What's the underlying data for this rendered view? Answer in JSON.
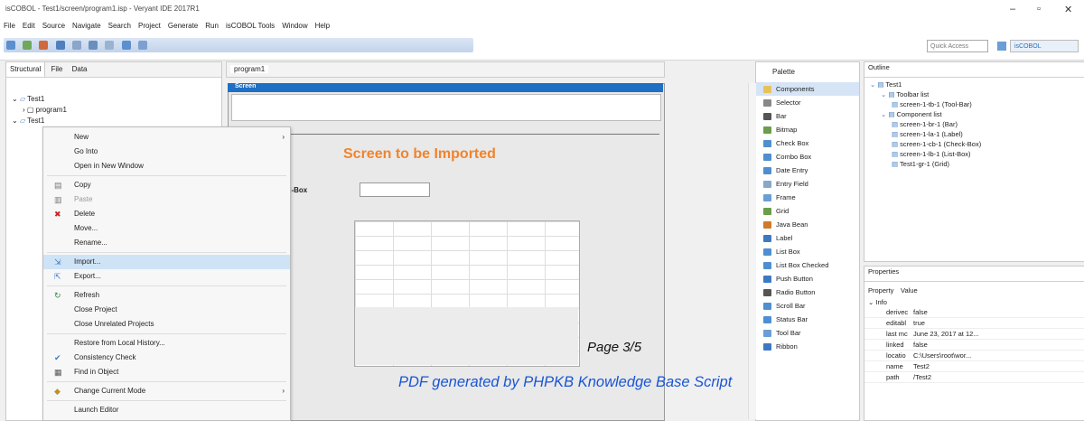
{
  "window": {
    "title": "isCOBOL - Test1/screen/program1.isp - Veryant IDE 2017R1",
    "minimize": "–",
    "maximize": "▫",
    "close": "✕"
  },
  "menubar": [
    "File",
    "Edit",
    "Source",
    "Navigate",
    "Search",
    "Project",
    "Generate",
    "Run",
    "isCOBOL Tools",
    "Window",
    "Help"
  ],
  "toolbar": {
    "quick_access": "Quick Access",
    "perspective": "isCOBOL"
  },
  "left_panel": {
    "tabs": [
      "Structural",
      "File",
      "Data"
    ],
    "tree": [
      "Test1",
      "program1",
      "Test1"
    ]
  },
  "context_menu": {
    "items": [
      {
        "label": "New",
        "submenu": true
      },
      {
        "label": "Go Into"
      },
      {
        "label": "Open in New Window"
      },
      {
        "sep": true
      },
      {
        "label": "Copy",
        "icon": "copy-icon"
      },
      {
        "label": "Paste",
        "icon": "paste-icon",
        "disabled": true
      },
      {
        "label": "Delete",
        "icon": "delete-icon"
      },
      {
        "label": "Move..."
      },
      {
        "label": "Rename..."
      },
      {
        "sep": true
      },
      {
        "label": "Import...",
        "icon": "import-icon",
        "highlighted": true
      },
      {
        "label": "Export...",
        "icon": "export-icon"
      },
      {
        "sep": true
      },
      {
        "label": "Refresh",
        "icon": "refresh-icon"
      },
      {
        "label": "Close Project"
      },
      {
        "label": "Close Unrelated Projects"
      },
      {
        "sep": true
      },
      {
        "label": "Restore from Local History..."
      },
      {
        "label": "Consistency Check",
        "icon": "check-icon"
      },
      {
        "label": "Find in Object",
        "icon": "find-icon"
      },
      {
        "sep": true
      },
      {
        "label": "Change Current Mode",
        "icon": "mode-icon",
        "submenu": true
      },
      {
        "sep": true
      },
      {
        "label": "Launch Editor"
      }
    ]
  },
  "editor": {
    "tab": "program1",
    "screen_header": "Screen",
    "title": "Screen to be Imported",
    "field_label": "k-Box"
  },
  "palette": {
    "title": "Palette",
    "group": "Components",
    "items": [
      "Selector",
      "Bar",
      "Bitmap",
      "Check Box",
      "Combo Box",
      "Date Entry",
      "Entry Field",
      "Frame",
      "Grid",
      "Java Bean",
      "Label",
      "List Box",
      "List Box Checked",
      "Push Button",
      "Radio Button",
      "Scroll Bar",
      "Status Bar",
      "Tool Bar",
      "Ribbon"
    ]
  },
  "outline": {
    "title": "Outline",
    "items": [
      {
        "label": "Test1",
        "indent": 0
      },
      {
        "label": "Toolbar list",
        "indent": 1
      },
      {
        "label": "screen-1-tb-1 (Tool-Bar)",
        "indent": 2
      },
      {
        "label": "Component list",
        "indent": 1
      },
      {
        "label": "screen-1-br-1 (Bar)",
        "indent": 2
      },
      {
        "label": "screen-1-la-1 (Label)",
        "indent": 2
      },
      {
        "label": "screen-1-cb-1 (Check-Box)",
        "indent": 2
      },
      {
        "label": "screen-1-lb-1 (List-Box)",
        "indent": 2
      },
      {
        "label": "Test1-gr-1 (Grid)",
        "indent": 2
      }
    ]
  },
  "properties": {
    "title": "Properties",
    "col_property": "Property",
    "col_value": "Value",
    "group": "Info",
    "rows": [
      {
        "k": "derivec",
        "v": "false"
      },
      {
        "k": "editabl",
        "v": "true"
      },
      {
        "k": "last mc",
        "v": "June 23, 2017 at 12..."
      },
      {
        "k": "linked",
        "v": "false"
      },
      {
        "k": "locatio",
        "v": "C:\\Users\\root\\wor..."
      },
      {
        "k": "name",
        "v": "Test2"
      },
      {
        "k": "path",
        "v": "/Test2"
      }
    ]
  },
  "watermark": {
    "page": "Page 3/5",
    "generator": "PDF generated by PHPKB Knowledge Base Script"
  }
}
